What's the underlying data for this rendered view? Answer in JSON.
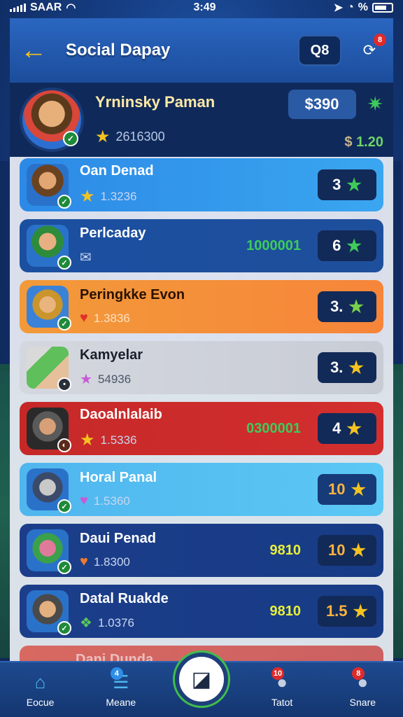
{
  "status_bar": {
    "carrier": "SAAR",
    "time": "3:49",
    "battery_text": "%"
  },
  "header": {
    "title": "Social Dapay",
    "button_label": "Q8",
    "share_badge": "8"
  },
  "profile": {
    "name": "Yrninsky Paman",
    "sub_value": "2616300",
    "money": "$390",
    "balance_currency": "$",
    "balance_value": "1.20"
  },
  "rows": [
    {
      "name": "Oan Denad",
      "sub": "1.3236",
      "score": "",
      "rank": "3",
      "star_color": "#3ecb5a"
    },
    {
      "name": "Perlcaday",
      "sub": "",
      "score": "1000001",
      "rank": "6",
      "star_color": "#3ecb5a"
    },
    {
      "name": "Peringkke Evon",
      "sub": "1.3836",
      "score": "",
      "rank": "3.",
      "star_color": "#7ad04a"
    },
    {
      "name": "Kamyelar",
      "sub": "54936",
      "score": "",
      "rank": "3.",
      "star_color": "#f5c320"
    },
    {
      "name": "Daoalnlalaib",
      "sub": "1.5336",
      "score": "0300001",
      "rank": "4",
      "star_color": "#f5c320"
    },
    {
      "name": "Horal Panal",
      "sub": "1.5360",
      "score": "",
      "rank": "10",
      "star_color": "#f5c320"
    },
    {
      "name": "Daui Penad",
      "sub": "1.8300",
      "score": "9810",
      "rank": "10",
      "star_color": "#f5c320"
    },
    {
      "name": "Datal Ruakde",
      "sub": "1.0376",
      "score": "9810",
      "rank": "1.5",
      "star_color": "#f5c320"
    },
    {
      "name": "Dani Dunda",
      "sub": "",
      "score": "",
      "rank": "",
      "star_color": "#f5c320"
    }
  ],
  "nav": {
    "items": [
      {
        "label": "Eocue"
      },
      {
        "label": "Meane",
        "badge": "4"
      },
      {
        "label": ""
      },
      {
        "label": "Tatot",
        "badge": "10"
      },
      {
        "label": "Snare",
        "badge": "8"
      }
    ]
  },
  "colors": {
    "accent_yellow": "#f5c320",
    "score_green": "#3ecb5a",
    "score_yellow": "#e8ef3a"
  }
}
